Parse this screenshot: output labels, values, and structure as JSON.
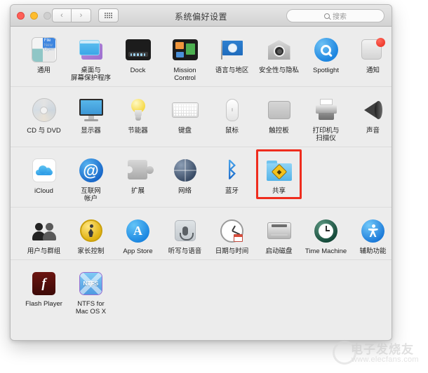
{
  "window": {
    "title": "系统偏好设置",
    "traffic_lights": [
      "close-red",
      "minimize-yellow",
      "zoom-gray"
    ],
    "nav": {
      "back": "‹",
      "forward": "›"
    },
    "grid_button": "show-all-grid",
    "search": {
      "placeholder": "搜索",
      "value": "",
      "icon": "search-icon"
    }
  },
  "highlight": {
    "target": "共享",
    "color": "#ef2c1d"
  },
  "rows": [
    {
      "panes": [
        {
          "label": "通用",
          "icon": "general-icon",
          "art": "general",
          "art_text": {
            "l1": "File",
            "l2": "New",
            "l3": "Open"
          }
        },
        {
          "label": "桌面与\n屏幕保护程序",
          "icon": "desktop-screensaver-icon",
          "art": "desktop"
        },
        {
          "label": "Dock",
          "icon": "dock-icon",
          "art": "dock"
        },
        {
          "label": "Mission\nControl",
          "icon": "mission-control-icon",
          "art": "mission"
        },
        {
          "label": "语言与地区",
          "icon": "language-region-icon",
          "art": "lang"
        },
        {
          "label": "安全性与隐私",
          "icon": "security-privacy-icon",
          "art": "sec"
        },
        {
          "label": "Spotlight",
          "icon": "spotlight-icon",
          "art": "spot"
        },
        {
          "label": "通知",
          "icon": "notifications-icon",
          "art": "notif"
        }
      ]
    },
    {
      "panes": [
        {
          "label": "CD 与 DVD",
          "icon": "cd-dvd-icon",
          "art": "cd"
        },
        {
          "label": "显示器",
          "icon": "displays-icon",
          "art": "disp"
        },
        {
          "label": "节能器",
          "icon": "energy-saver-icon",
          "art": "energy"
        },
        {
          "label": "键盘",
          "icon": "keyboard-icon",
          "art": "kbd"
        },
        {
          "label": "鼠标",
          "icon": "mouse-icon",
          "art": "mouse"
        },
        {
          "label": "触控板",
          "icon": "trackpad-icon",
          "art": "track"
        },
        {
          "label": "打印机与\n扫描仪",
          "icon": "printers-scanners-icon",
          "art": "print"
        },
        {
          "label": "声音",
          "icon": "sound-icon",
          "art": "sound"
        }
      ]
    },
    {
      "panes": [
        {
          "label": "iCloud",
          "icon": "icloud-icon",
          "art": "icloud"
        },
        {
          "label": "互联网\n帐户",
          "icon": "internet-accounts-icon",
          "art": "at",
          "art_text": {
            "l1": "@"
          }
        },
        {
          "label": "扩展",
          "icon": "extensions-icon",
          "art": "puzzle"
        },
        {
          "label": "网络",
          "icon": "network-icon",
          "art": "net"
        },
        {
          "label": "蓝牙",
          "icon": "bluetooth-icon",
          "art": "bt",
          "art_text": {
            "l1": "ᛒ"
          }
        },
        {
          "label": "共享",
          "icon": "sharing-icon",
          "art": "share",
          "highlighted": true
        }
      ]
    },
    {
      "panes": [
        {
          "label": "用户与群组",
          "icon": "users-groups-icon",
          "art": "users"
        },
        {
          "label": "家长控制",
          "icon": "parental-controls-icon",
          "art": "parent"
        },
        {
          "label": "App Store",
          "icon": "app-store-icon",
          "art": "appstore",
          "art_text": {
            "l1": "A"
          }
        },
        {
          "label": "听写与语音",
          "icon": "dictation-speech-icon",
          "art": "mic"
        },
        {
          "label": "日期与时间",
          "icon": "date-time-icon",
          "art": "clock"
        },
        {
          "label": "启动磁盘",
          "icon": "startup-disk-icon",
          "art": "hdd"
        },
        {
          "label": "Time Machine",
          "icon": "time-machine-icon",
          "art": "tm"
        },
        {
          "label": "辅助功能",
          "icon": "accessibility-icon",
          "art": "acc"
        }
      ]
    },
    {
      "panes": [
        {
          "label": "Flash Player",
          "icon": "flash-player-icon",
          "art": "flash",
          "art_text": {
            "l1": "f"
          }
        },
        {
          "label": "NTFS for\nMac OS X",
          "icon": "ntfs-icon",
          "art": "ntfs",
          "art_text": {
            "l1": "NTFS"
          }
        }
      ]
    }
  ],
  "watermark": {
    "brand": "电子发烧友",
    "url": "www.elecfans.com"
  }
}
